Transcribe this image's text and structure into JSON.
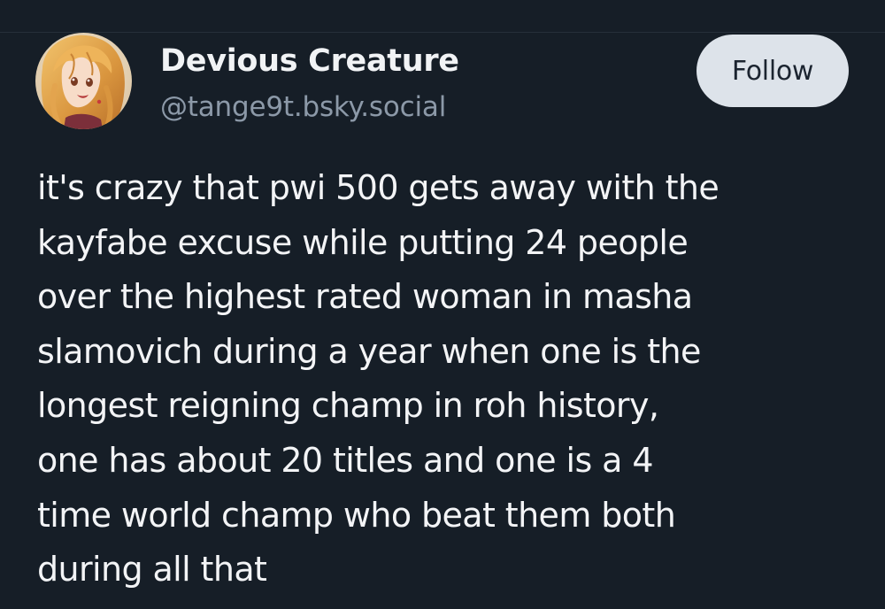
{
  "author": {
    "display_name": "Devious Creature",
    "handle": "@tange9t.bsky.social",
    "avatar_icon": "anime-character-avatar"
  },
  "actions": {
    "follow_label": "Follow"
  },
  "post": {
    "lines": [
      "it's crazy that pwi 500 gets away with the",
      "kayfabe excuse while putting 24 people",
      "over the highest rated woman in masha",
      "slamovich during a year when one is the",
      "longest reigning champ in roh history,",
      "one has about 20 titles and one is a 4",
      "time world champ who beat them both",
      "during all that"
    ]
  },
  "colors": {
    "background": "#161e27",
    "text": "#f1f3f5",
    "handle": "#8c99a8",
    "button_bg": "#dde3ea",
    "button_text": "#1b2430"
  }
}
